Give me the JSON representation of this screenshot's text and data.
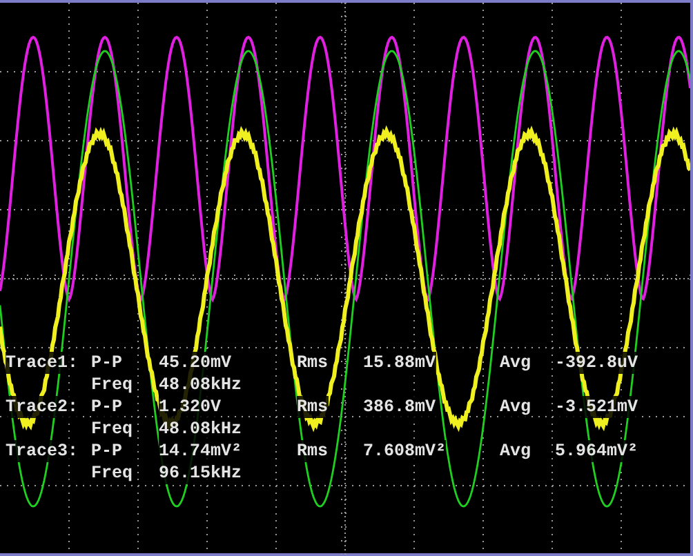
{
  "measurements": [
    {
      "trace": "Trace1:",
      "pp_label": "P-P",
      "pp": "45.20mV",
      "rms_label": "Rms",
      "rms": "15.88mV",
      "avg_label": "Avg",
      "avg": "-392.8uV",
      "freq_label": "Freq",
      "freq": "48.08kHz"
    },
    {
      "trace": "Trace2:",
      "pp_label": "P-P",
      "pp": "1.320V",
      "rms_label": "Rms",
      "rms": "386.8mV",
      "avg_label": "Avg",
      "avg": "-3.521mV",
      "freq_label": "Freq",
      "freq": "48.08kHz"
    },
    {
      "trace": "Trace3:",
      "pp_label": "P-P",
      "pp": "14.74mV²",
      "rms_label": "Rms",
      "rms": "7.608mV²",
      "avg_label": "Avg",
      "avg": "5.964mV²",
      "freq_label": "Freq",
      "freq": "96.15kHz"
    }
  ]
}
